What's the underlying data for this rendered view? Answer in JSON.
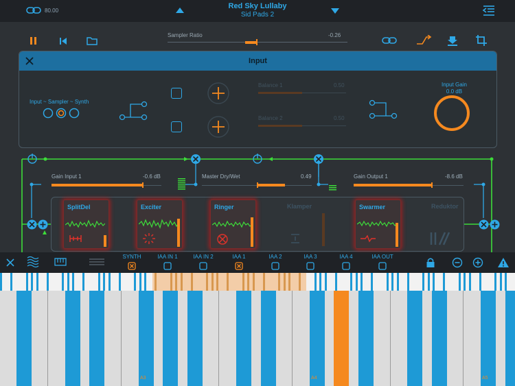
{
  "header": {
    "tempo": "80.00",
    "title": "Red Sky Lullaby",
    "subtitle": "Sid Pads 2"
  },
  "transport": {
    "sampler_ratio_label": "Sampler Ratio",
    "sampler_ratio_value": "-0.26"
  },
  "input_panel": {
    "title": "Input",
    "route_label": "Input ~ Sampler ~ Synth",
    "balance1_label": "Balance 1",
    "balance1_value": "0.50",
    "balance2_label": "Balance 2",
    "balance2_value": "0.50",
    "input_gain_label": "Input Gain",
    "input_gain_value": "0.0 dB"
  },
  "mixer": {
    "gain_input_label": "Gain Input 1",
    "gain_input_value": "-0.6 dB",
    "dry_wet_label": "Master Dry/Wet",
    "dry_wet_value": "0.49",
    "gain_output_label": "Gain Output 1",
    "gain_output_value": "-8.6 dB"
  },
  "effects": [
    {
      "name": "SplitDel",
      "active": true
    },
    {
      "name": "Exciter",
      "active": true
    },
    {
      "name": "Ringer",
      "active": true
    },
    {
      "name": "Klamper",
      "active": false
    },
    {
      "name": "Swarmer",
      "active": true
    },
    {
      "name": "Reduktor",
      "active": false
    }
  ],
  "iaa": {
    "labels": [
      "SYNTH",
      "IAA IN 1",
      "IAA IN 2",
      "IAA 1",
      "IAA 2",
      "IAA 3",
      "IAA 4",
      "IAA OUT"
    ]
  },
  "keyboard": {
    "notes": [
      "A3",
      "A4",
      "A5"
    ]
  },
  "colors": {
    "accent_blue": "#2fa8e6",
    "accent_orange": "#f5891f",
    "route_green": "#3ddc3a",
    "background": "#2d3135"
  }
}
